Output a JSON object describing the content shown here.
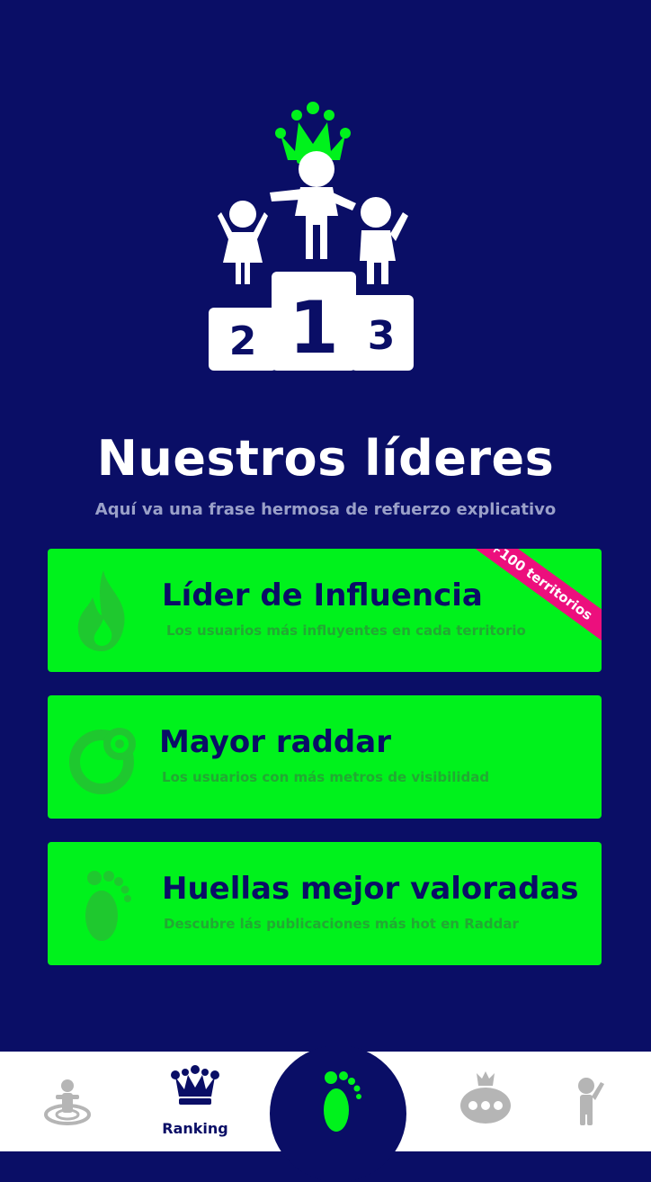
{
  "header": {
    "title": "Nuestros líderes",
    "subtitle": "Aquí va una frase hermosa de refuerzo explicativo",
    "podium_numbers": [
      "2",
      "1",
      "3"
    ]
  },
  "cards": [
    {
      "title": "Líder de Influencia",
      "description": "Los usuarios más influyentes en cada territorio",
      "badge": "+100 territorios",
      "icon": "flame-icon"
    },
    {
      "title": "Mayor raddar",
      "description": "Los usuarios con más metros de visibilidad",
      "icon": "radar-icon"
    },
    {
      "title": "Huellas mejor valoradas",
      "description": "Descubre lás publicaciones más hot en Raddar",
      "icon": "footprint-icon"
    }
  ],
  "tabbar": {
    "items": [
      {
        "icon": "person-radar-icon",
        "label": ""
      },
      {
        "icon": "crown-icon",
        "label": "Ranking"
      },
      {
        "icon": "footprint-icon",
        "label": ""
      },
      {
        "icon": "money-bag-icon",
        "label": ""
      },
      {
        "icon": "person-waving-icon",
        "label": ""
      }
    ]
  },
  "colors": {
    "background": "#0a0e66",
    "accent_green": "#00f21c",
    "card_text": "#0a0e66",
    "badge": "#ec0f7d",
    "inactive_icon": "#b5b5b5"
  }
}
